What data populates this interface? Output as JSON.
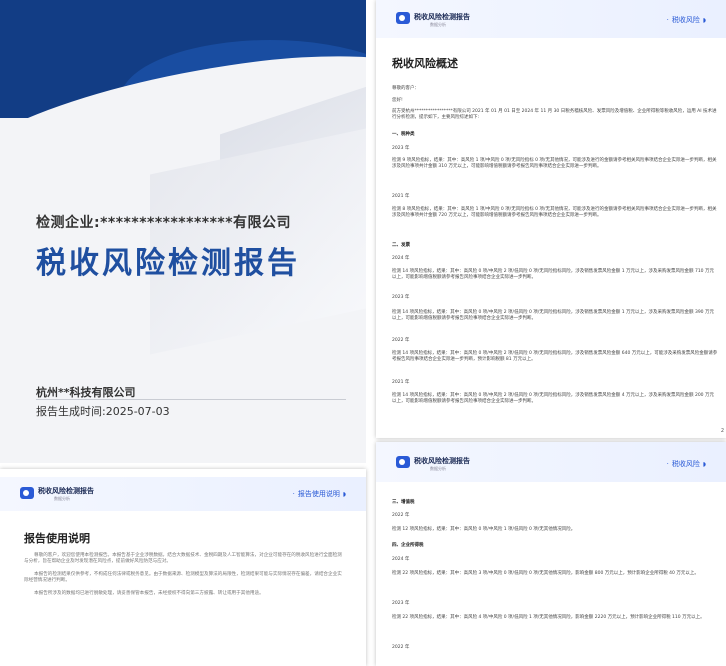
{
  "cover": {
    "subject": "检测企业:*****************有限公司",
    "title": "税收风险检测报告",
    "company": "杭州**科技有限公司",
    "generated": "报告生成时间:2025-07-03"
  },
  "header": {
    "brand": "税收风险检测报告",
    "brand_sub": "数据分析"
  },
  "usage": {
    "section_tag": "报告使用说明",
    "title": "报告使用说明",
    "paragraphs": [
      "尊敬的客户，欢迎您使用本检测报告。本报告基于企业涉税数据，结合大数据技术、金税四期及人工智能算法，对企业可能存在的税收风险进行全面检测与分析，旨在帮助企业及时发现潜在风险点，提前做好风险防范与应对。",
      "本报告的检测结果仅供参考，不构成任何法律或税务意见。由于数据来源、检测模型及算法的局限性，检测结果可能与实际情况存在偏差，请结合企业实际经营情况进行判断。",
      "本报告所涉及的数据均已进行脱敏处理，请妥善保管本报告，未经授权不得向第三方披露、转让或用于其他用途。"
    ]
  },
  "overview": {
    "section_tag": "税收风险",
    "title": "税收风险概述",
    "greeting": "尊敬的客户：",
    "hello": "您好!",
    "intro": "前方受杭州*****************有限公司 2021 年 01 月 01 日至 2024 年 11 月 30 日税务稽核风险、发票风险及增值税、企业所得税等税收风险，运用 AI 技术进行分析检测，提示如下，主要风险综述如下:",
    "sec1": "一、税种类",
    "y2023": "2023 年",
    "p1": "检测 9 项风险指标，结果：其中：高风险 1 项/中风险 0 项/无风险指标 0 项/无其他情况，可能涉及进行的金额请参考相关风险事项结合企业实际进一步判断，相关涉及风险事项共计金额 310 万元以上，可能影响增值税额请参考报告风险事项结合企业实际进一步判断。",
    "y2021": "2021 年",
    "p2": "检测 8 项风险指标，结果：其中：高风险 1 项/中风险 0 项/无风险指标 0 项/无其他情况，可能涉及进行的金额请参考相关风险事项结合企业实际进一步判断，相关涉及风险事项共计金额 720 万元以上，可能影响增值税额请参考报告风险事项结合企业实际进一步判断。",
    "sec2": "二、发票",
    "y2024": "2024 年",
    "p3": "检测 14 项风险指标，结果：其中：高风险 0 项/中风险 2 项/低风险 0 项/无风险指标风险，涉及销售发票风险金额 1 万元以上，涉及采购发票风险金额 710 万元以上，可能影响增值税额请参考报告风险事项结合企业实际进一步判断。",
    "y2023b": "2023 年",
    "p4": "检测 14 项风险指标，结果：其中：高风险 0 项/中风险 2 项/低风险 0 项/无风险指标风险，涉及销售发票风险金额 1 万元以上，涉及采购发票风险金额 390 万元以上，可能影响增值税额请参考报告风险事项结合企业实际进一步判断。",
    "y2022": "2022 年",
    "p5": "检测 14 项风险指标，结果：其中：高风险 0 项/中风险 2 项/低风险 0 项/无风险指标风险，涉及销售发票风险金额 640 万元以上，可能涉及采购发票风险金额请参考报告风险事项结合企业实际进一步判断，预计影响税额 81 万元以上。",
    "y2021b": "2021 年",
    "p6": "检测 14 项风险指标，结果：其中：高风险 0 项/中风险 2 项/低风险 0 项/无风险指标风险，涉及销售发票风险金额 4 万元以上，涉及采购发票风险金额 200 万元以上，可能影响增值税额请参考报告风险事项结合企业实际进一步判断。",
    "page": "2"
  },
  "cont": {
    "section_tag": "税收风险",
    "sec3": "三、增值税",
    "y2022": "2022 年",
    "p1": "检测 12 项风险指标，结果：其中：高风险 0 项/中风险 1 项/低风险 0 项/无其他情况风险。",
    "sec4": "四、企业所得税",
    "y2024": "2024 年",
    "p2": "检测 22 项风险指标，结果：其中：高风险 3 项/中风险 0 项/低风险 0 项/无其他情况风险，影响金额 800 万元以上，预计影响企业所得税 40 万元以上。",
    "y2023": "2023 年",
    "p3": "检测 22 项风险指标，结果：其中：高风险 4 项/中风险 0 项/低风险 1 项/无其他情况风险，影响金额 2220 万元以上，预计影响企业所得税 110 万元以上。",
    "y2022b": "2022 年"
  }
}
